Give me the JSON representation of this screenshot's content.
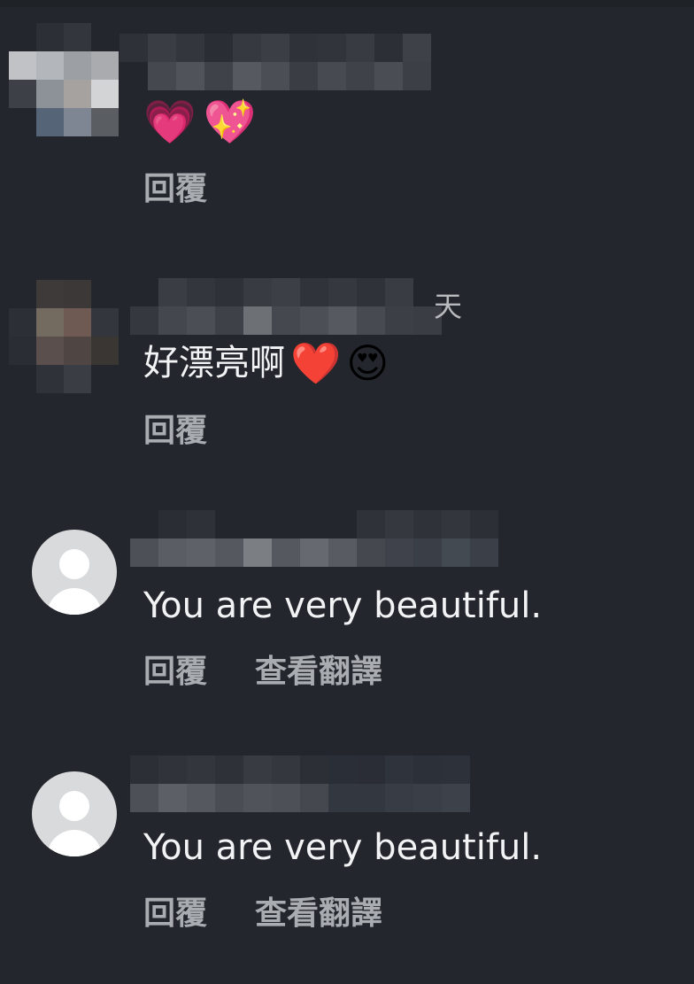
{
  "comments": [
    {
      "username_hidden": true,
      "tail_char": "",
      "text": "",
      "emojis": [
        "💗",
        "💖"
      ],
      "actions": {
        "reply": "回覆"
      }
    },
    {
      "username_hidden": true,
      "tail_char": "天",
      "text": "好漂亮啊",
      "emojis": [
        "❤️",
        "😍"
      ],
      "actions": {
        "reply": "回覆"
      }
    },
    {
      "username_hidden": true,
      "text": "You are very beautiful.",
      "actions": {
        "reply": "回覆",
        "translate": "查看翻譯"
      }
    },
    {
      "username_hidden": true,
      "text": "You are very beautiful.",
      "actions": {
        "reply": "回覆",
        "translate": "查看翻譯"
      }
    }
  ]
}
